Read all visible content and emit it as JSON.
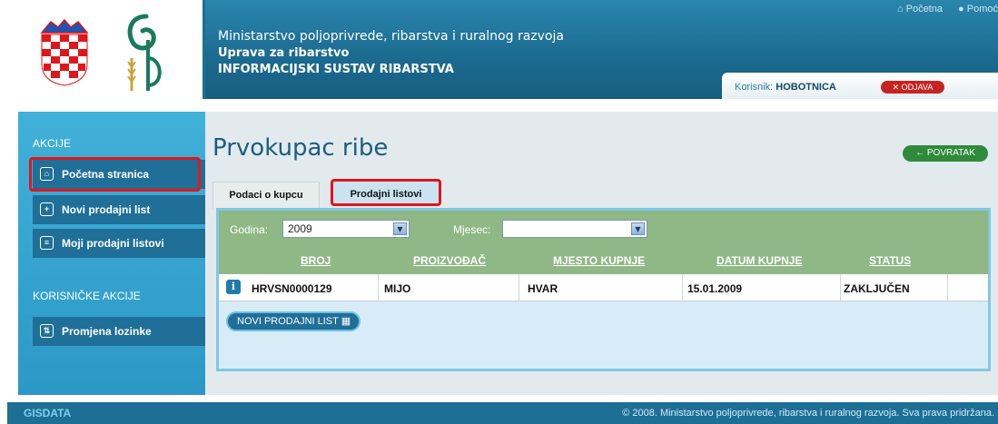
{
  "header": {
    "line1": "Ministarstvo poljoprivrede, ribarstva i ruralnog razvoja",
    "line2": "Uprava za ribarstvo",
    "line3": "INFORMACIJSKI SUSTAV RIBARSTVA",
    "home_link": "Početna",
    "help_link": "Pomoć",
    "user_label": "Korisnik:",
    "user_name": "HOBOTNICA",
    "logout": "ODJAVA"
  },
  "sidebar": {
    "section1": "AKCIJE",
    "items": [
      {
        "label": "Početna stranica",
        "icon": "home-icon"
      },
      {
        "label": "Novi prodajni list",
        "icon": "new-document-icon"
      },
      {
        "label": "Moji prodajni listovi",
        "icon": "documents-icon"
      }
    ],
    "section2": "KORISNIČKE AKCIJE",
    "user_items": [
      {
        "label": "Promjena lozinke",
        "icon": "password-icon"
      }
    ]
  },
  "main": {
    "title": "Prvokupac ribe",
    "back": "POVRATAK",
    "tabs": [
      "Podaci o kupcu",
      "Prodajni listovi"
    ],
    "filters": {
      "year_label": "Godina:",
      "year_value": "2009",
      "month_label": "Mjesec:",
      "month_value": ""
    },
    "columns": [
      "BROJ",
      "PROIZVOĐAČ",
      "MJESTO KUPNJE",
      "DATUM KUPNJE",
      "STATUS"
    ],
    "rows": [
      {
        "broj": "HRVSN0000129",
        "proizvodac": "MIJO",
        "mjesto": "HVAR",
        "datum": "15.01.2009",
        "status": "ZAKLJUČEN"
      }
    ],
    "new_button": "NOVI PRODAJNI LIST"
  },
  "footer": {
    "brand": "GISDATA",
    "copyright": "© 2008. Ministarstvo poljoprivrede, ribarstva i ruralnog razvoja. Sva prava pridržana."
  },
  "colors": {
    "header": "#1d6f95",
    "sidebar": "#41b1d9",
    "nav_item": "#1f6f98",
    "table_header": "#8fb886",
    "highlight": "#e0161c",
    "back_button": "#2f8a3c",
    "logout_button": "#c82323"
  }
}
